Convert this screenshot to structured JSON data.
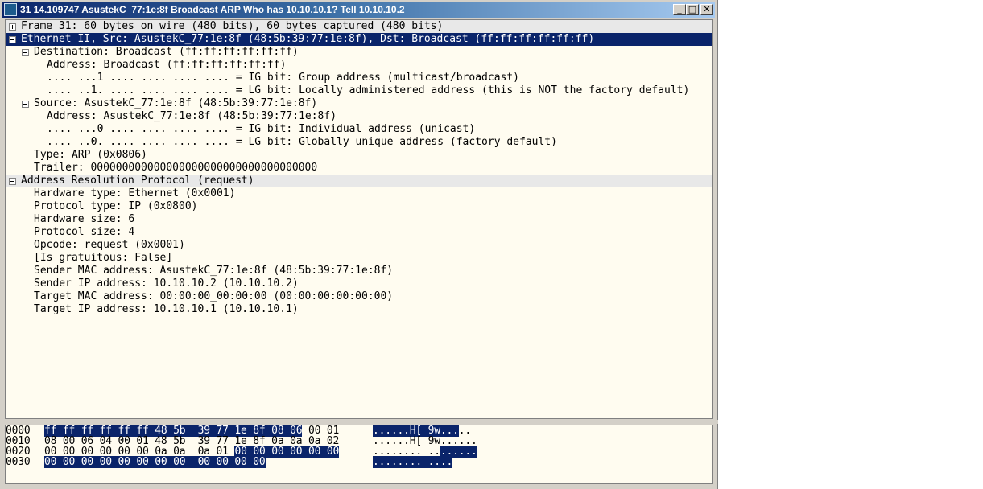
{
  "window": {
    "title": "31 14.109747 AsustekC_77:1e:8f Broadcast ARP Who has 10.10.10.1?  Tell 10.10.10.2",
    "buttons": {
      "minimize": "_",
      "maximize": "□",
      "close": "✕"
    }
  },
  "tree": [
    {
      "level": 0,
      "exp": "plus",
      "style": "shade",
      "text": "Frame 31: 60 bytes on wire (480 bits), 60 bytes captured (480 bits)"
    },
    {
      "level": 0,
      "exp": "minus",
      "style": "sel",
      "text": "Ethernet II, Src: AsustekC_77:1e:8f (48:5b:39:77:1e:8f), Dst: Broadcast (ff:ff:ff:ff:ff:ff)"
    },
    {
      "level": 1,
      "exp": "minus",
      "text": "Destination: Broadcast (ff:ff:ff:ff:ff:ff)"
    },
    {
      "level": 2,
      "text": "Address: Broadcast (ff:ff:ff:ff:ff:ff)"
    },
    {
      "level": 2,
      "text": ".... ...1 .... .... .... .... = IG bit: Group address (multicast/broadcast)"
    },
    {
      "level": 2,
      "text": ".... ..1. .... .... .... .... = LG bit: Locally administered address (this is NOT the factory default)"
    },
    {
      "level": 1,
      "exp": "minus",
      "text": "Source: AsustekC_77:1e:8f (48:5b:39:77:1e:8f)"
    },
    {
      "level": 2,
      "text": "Address: AsustekC_77:1e:8f (48:5b:39:77:1e:8f)"
    },
    {
      "level": 2,
      "text": ".... ...0 .... .... .... .... = IG bit: Individual address (unicast)"
    },
    {
      "level": 2,
      "text": ".... ..0. .... .... .... .... = LG bit: Globally unique address (factory default)"
    },
    {
      "level": 1,
      "text": "Type: ARP (0x0806)"
    },
    {
      "level": 1,
      "text": "Trailer: 000000000000000000000000000000000000"
    },
    {
      "level": 0,
      "exp": "minus",
      "style": "shade",
      "text": "Address Resolution Protocol (request)"
    },
    {
      "level": 1,
      "text": "Hardware type: Ethernet (0x0001)"
    },
    {
      "level": 1,
      "text": "Protocol type: IP (0x0800)"
    },
    {
      "level": 1,
      "text": "Hardware size: 6"
    },
    {
      "level": 1,
      "text": "Protocol size: 4"
    },
    {
      "level": 1,
      "text": "Opcode: request (0x0001)"
    },
    {
      "level": 1,
      "text": "[Is gratuitous: False]"
    },
    {
      "level": 1,
      "text": "Sender MAC address: AsustekC_77:1e:8f (48:5b:39:77:1e:8f)"
    },
    {
      "level": 1,
      "text": "Sender IP address: 10.10.10.2 (10.10.10.2)"
    },
    {
      "level": 1,
      "text": "Target MAC address: 00:00:00_00:00:00 (00:00:00:00:00:00)"
    },
    {
      "level": 1,
      "text": "Target IP address: 10.10.10.1 (10.10.10.1)"
    }
  ],
  "hex": [
    {
      "offset": "0000",
      "bytes": [
        {
          "t": "ff ff ff ff ff ff 48 5b  39 77 1e 8f 08 06",
          "hl": true
        },
        {
          "t": " 00 01",
          "hl": false
        }
      ],
      "ascii": [
        {
          "t": "......H[ 9w...",
          "hl": true
        },
        {
          "t": "..",
          "hl": false
        }
      ]
    },
    {
      "offset": "0010",
      "bytes": [
        {
          "t": "08 00 06 04 00 01 48 5b  39 77 1e 8f 0a 0a 0a 02",
          "hl": false
        }
      ],
      "ascii": [
        {
          "t": "......H[ 9w......",
          "hl": false
        }
      ]
    },
    {
      "offset": "0020",
      "bytes": [
        {
          "t": "00 00 00 00 00 00 0a 0a  0a 01 ",
          "hl": false
        },
        {
          "t": "00 00 00 00 00 00",
          "hl": true
        }
      ],
      "ascii": [
        {
          "t": "........ ..",
          "hl": false
        },
        {
          "t": "......",
          "hl": true
        }
      ]
    },
    {
      "offset": "0030",
      "bytes": [
        {
          "t": "00 00 00 00 00 00 00 00  00 00 00 00",
          "hl": true
        }
      ],
      "ascii": [
        {
          "t": "........ ....",
          "hl": true
        }
      ]
    }
  ]
}
